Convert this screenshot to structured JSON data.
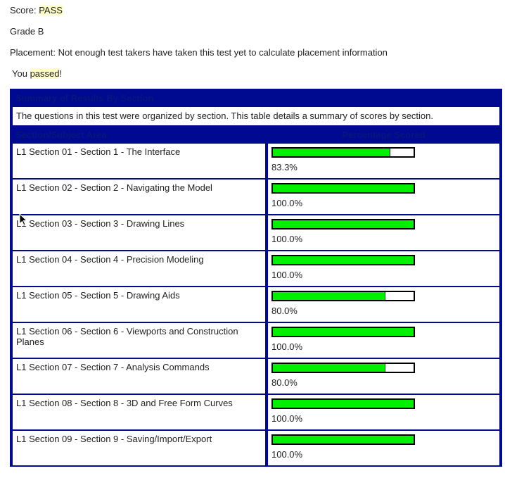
{
  "score": {
    "label": "Score: ",
    "value": "PASS"
  },
  "grade": "Grade B",
  "placement": "Placement: Not enough test takers have taken this test yet to calculate placement information",
  "result": {
    "prefix": "You ",
    "highlight": "passed",
    "suffix": "!"
  },
  "table": {
    "title": "Summary of Results By Section",
    "description": "The questions in this test were organized by section. This table details a summary of scores by section.",
    "col_section": "Section/Subject Area",
    "col_percent": "Percentage Scored"
  },
  "sections": [
    {
      "name": "L1 Section 01 - Section 1 - The Interface",
      "percent": 83.3,
      "percent_label": "83.3%"
    },
    {
      "name": "L1 Section 02 - Section 2 - Navigating the Model",
      "percent": 100.0,
      "percent_label": "100.0%"
    },
    {
      "name": "L1 Section 03 - Section 3 - Drawing Lines",
      "percent": 100.0,
      "percent_label": "100.0%"
    },
    {
      "name": "L1 Section 04 - Section 4 - Precision Modeling",
      "percent": 100.0,
      "percent_label": "100.0%"
    },
    {
      "name": "L1 Section 05 - Section 5 - Drawing Aids",
      "percent": 80.0,
      "percent_label": "80.0%"
    },
    {
      "name": "L1 Section 06 - Section 6 - Viewports and Construction Planes",
      "percent": 100.0,
      "percent_label": "100.0%"
    },
    {
      "name": "L1 Section 07 - Section 7 - Analysis Commands",
      "percent": 80.0,
      "percent_label": "80.0%"
    },
    {
      "name": "L1 Section 08 - Section 8 - 3D and Free Form Curves",
      "percent": 100.0,
      "percent_label": "100.0%"
    },
    {
      "name": "L1 Section 09 - Section 9 - Saving/Import/Export",
      "percent": 100.0,
      "percent_label": "100.0%"
    }
  ],
  "colors": {
    "table_border": "#000a91",
    "bar_fill": "#00f000",
    "highlight": "#ffffc8"
  },
  "icons": {
    "cursor": "mouse-pointer-icon"
  }
}
